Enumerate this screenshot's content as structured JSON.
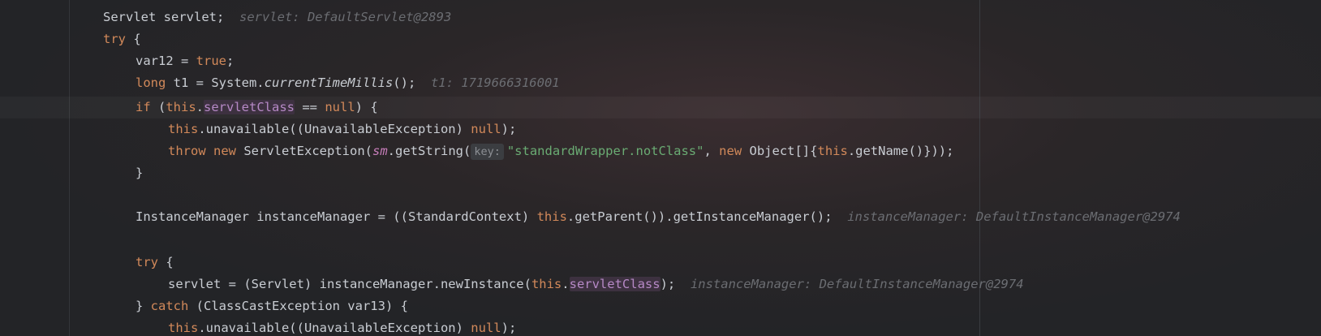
{
  "editor": {
    "lines": [
      {
        "parts": [
          "Servlet servlet;"
        ],
        "hint": "servlet: DefaultServlet@2893"
      },
      {
        "parts": [
          "try",
          " {"
        ]
      },
      {
        "parts": [
          "var12 = ",
          "true",
          ";"
        ]
      },
      {
        "parts": [
          "long",
          " t1 = System.",
          "currentTimeMillis",
          "();"
        ],
        "hint": "t1: 1719666316001"
      },
      {
        "parts": [
          "if",
          " (",
          "this",
          ".",
          "servletClass",
          " == ",
          "null",
          ") {"
        ]
      },
      {
        "parts": [
          "this",
          ".unavailable((UnavailableException) ",
          "null",
          ");"
        ]
      },
      {
        "parts": [
          "throw",
          " ",
          "new",
          " ServletException(",
          "sm",
          ".getString(",
          "key:",
          "\"standardWrapper.notClass\"",
          ", ",
          "new",
          " Object[]{",
          "this",
          ".getName()}));"
        ]
      },
      {
        "parts": [
          "}"
        ]
      },
      {
        "parts": [
          "InstanceManager instanceManager = ((StandardContext) ",
          "this",
          ".getParent()).getInstanceManager();"
        ],
        "hint": "instanceManager: DefaultInstanceManager@2974"
      },
      {
        "parts": [
          "try",
          " {"
        ]
      },
      {
        "parts": [
          "servlet = (Servlet) instanceManager.newInstance(",
          "this",
          ".",
          "servletClass",
          ");"
        ],
        "hint": "instanceManager: DefaultInstanceManager@2974"
      },
      {
        "parts": [
          "} ",
          "catch",
          " (ClassCastException var13) {"
        ]
      },
      {
        "parts": [
          "this",
          ".unavailable((UnavailableException) ",
          "null",
          ");"
        ]
      }
    ]
  }
}
